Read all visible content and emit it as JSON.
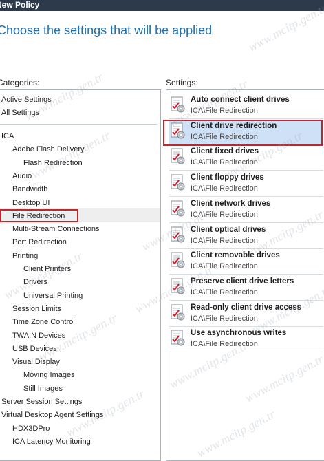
{
  "window": {
    "title": "New Policy"
  },
  "heading": "Choose the settings that will be applied",
  "categories_label": "Categories:",
  "settings_label": "Settings:",
  "categories": {
    "top": [
      "Active Settings",
      "All Settings"
    ],
    "tree": [
      {
        "label": "ICA",
        "level": 0
      },
      {
        "label": "Adobe Flash Delivery",
        "level": 1
      },
      {
        "label": "Flash Redirection",
        "level": 2
      },
      {
        "label": "Audio",
        "level": 1
      },
      {
        "label": "Bandwidth",
        "level": 1
      },
      {
        "label": "Desktop UI",
        "level": 1
      },
      {
        "label": "File Redirection",
        "level": 1,
        "selected": true
      },
      {
        "label": "Multi-Stream Connections",
        "level": 1
      },
      {
        "label": "Port Redirection",
        "level": 1
      },
      {
        "label": "Printing",
        "level": 1
      },
      {
        "label": "Client Printers",
        "level": 2
      },
      {
        "label": "Drivers",
        "level": 2
      },
      {
        "label": "Universal Printing",
        "level": 2
      },
      {
        "label": "Session Limits",
        "level": 1
      },
      {
        "label": "Time Zone Control",
        "level": 1
      },
      {
        "label": "TWAIN Devices",
        "level": 1
      },
      {
        "label": "USB Devices",
        "level": 1
      },
      {
        "label": "Visual Display",
        "level": 1
      },
      {
        "label": "Moving Images",
        "level": 2
      },
      {
        "label": "Still Images",
        "level": 2
      },
      {
        "label": "Server Session Settings",
        "level": 0
      },
      {
        "label": "Virtual Desktop Agent Settings",
        "level": 0
      },
      {
        "label": "HDX3DPro",
        "level": 1
      },
      {
        "label": "ICA Latency Monitoring",
        "level": 1
      }
    ]
  },
  "settings": [
    {
      "title": "Auto connect client drives",
      "path": "ICA\\File Redirection"
    },
    {
      "title": "Client drive redirection",
      "path": "ICA\\File Redirection",
      "selected": true
    },
    {
      "title": "Client fixed drives",
      "path": "ICA\\File Redirection"
    },
    {
      "title": "Client floppy drives",
      "path": "ICA\\File Redirection"
    },
    {
      "title": "Client network drives",
      "path": "ICA\\File Redirection"
    },
    {
      "title": "Client optical drives",
      "path": "ICA\\File Redirection"
    },
    {
      "title": "Client removable drives",
      "path": "ICA\\File Redirection"
    },
    {
      "title": "Preserve client drive letters",
      "path": "ICA\\File Redirection"
    },
    {
      "title": "Read-only client drive access",
      "path": "ICA\\File Redirection"
    },
    {
      "title": "Use asynchronous writes",
      "path": "ICA\\File Redirection"
    }
  ],
  "watermark": "www.mcitp.gen.tr",
  "colors": {
    "title_bar": "#2d3a4c",
    "heading": "#1f6fae",
    "highlight": "#c0262e",
    "selection": "#cfe1f6"
  }
}
